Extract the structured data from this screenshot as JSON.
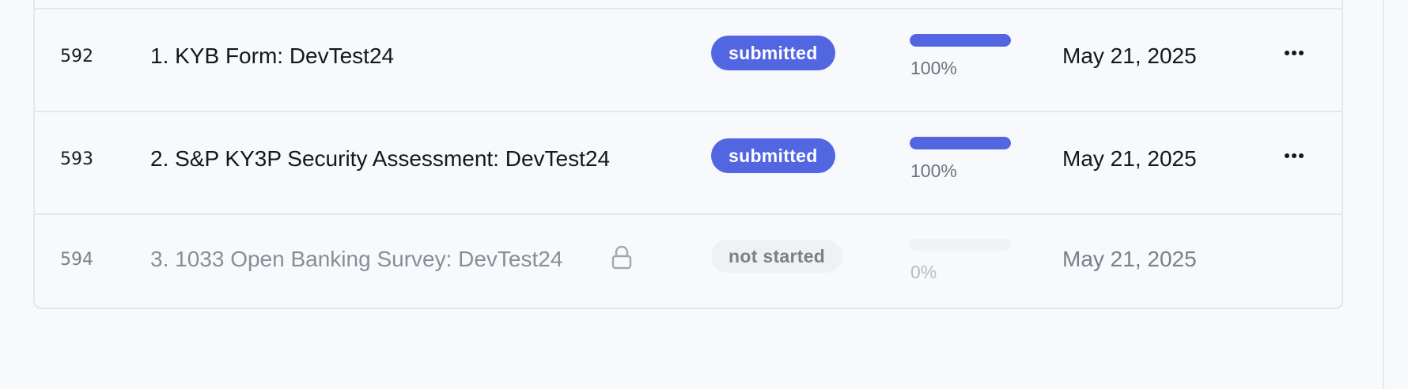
{
  "rows": [
    {
      "id": "592",
      "name": "1. KYB Form: DevTest24",
      "status": "submitted",
      "progress": 100,
      "progress_label": "100%",
      "date": "May 21, 2025",
      "locked": false,
      "has_menu": true
    },
    {
      "id": "593",
      "name": "2. S&P KY3P Security Assessment: DevTest24",
      "status": "submitted",
      "progress": 100,
      "progress_label": "100%",
      "date": "May 21, 2025",
      "locked": false,
      "has_menu": true
    },
    {
      "id": "594",
      "name": "3. 1033 Open Banking Survey: DevTest24",
      "status": "not started",
      "progress": 0,
      "progress_label": "0%",
      "date": "May 21, 2025",
      "locked": true,
      "has_menu": false
    }
  ],
  "colors": {
    "accent": "#5266e2",
    "row_border": "#e3e6ee",
    "background": "#f8f9fd",
    "muted_text": "#8a8d96"
  },
  "icons": {
    "menu": "more-horizontal-icon",
    "lock": "lock-icon"
  }
}
